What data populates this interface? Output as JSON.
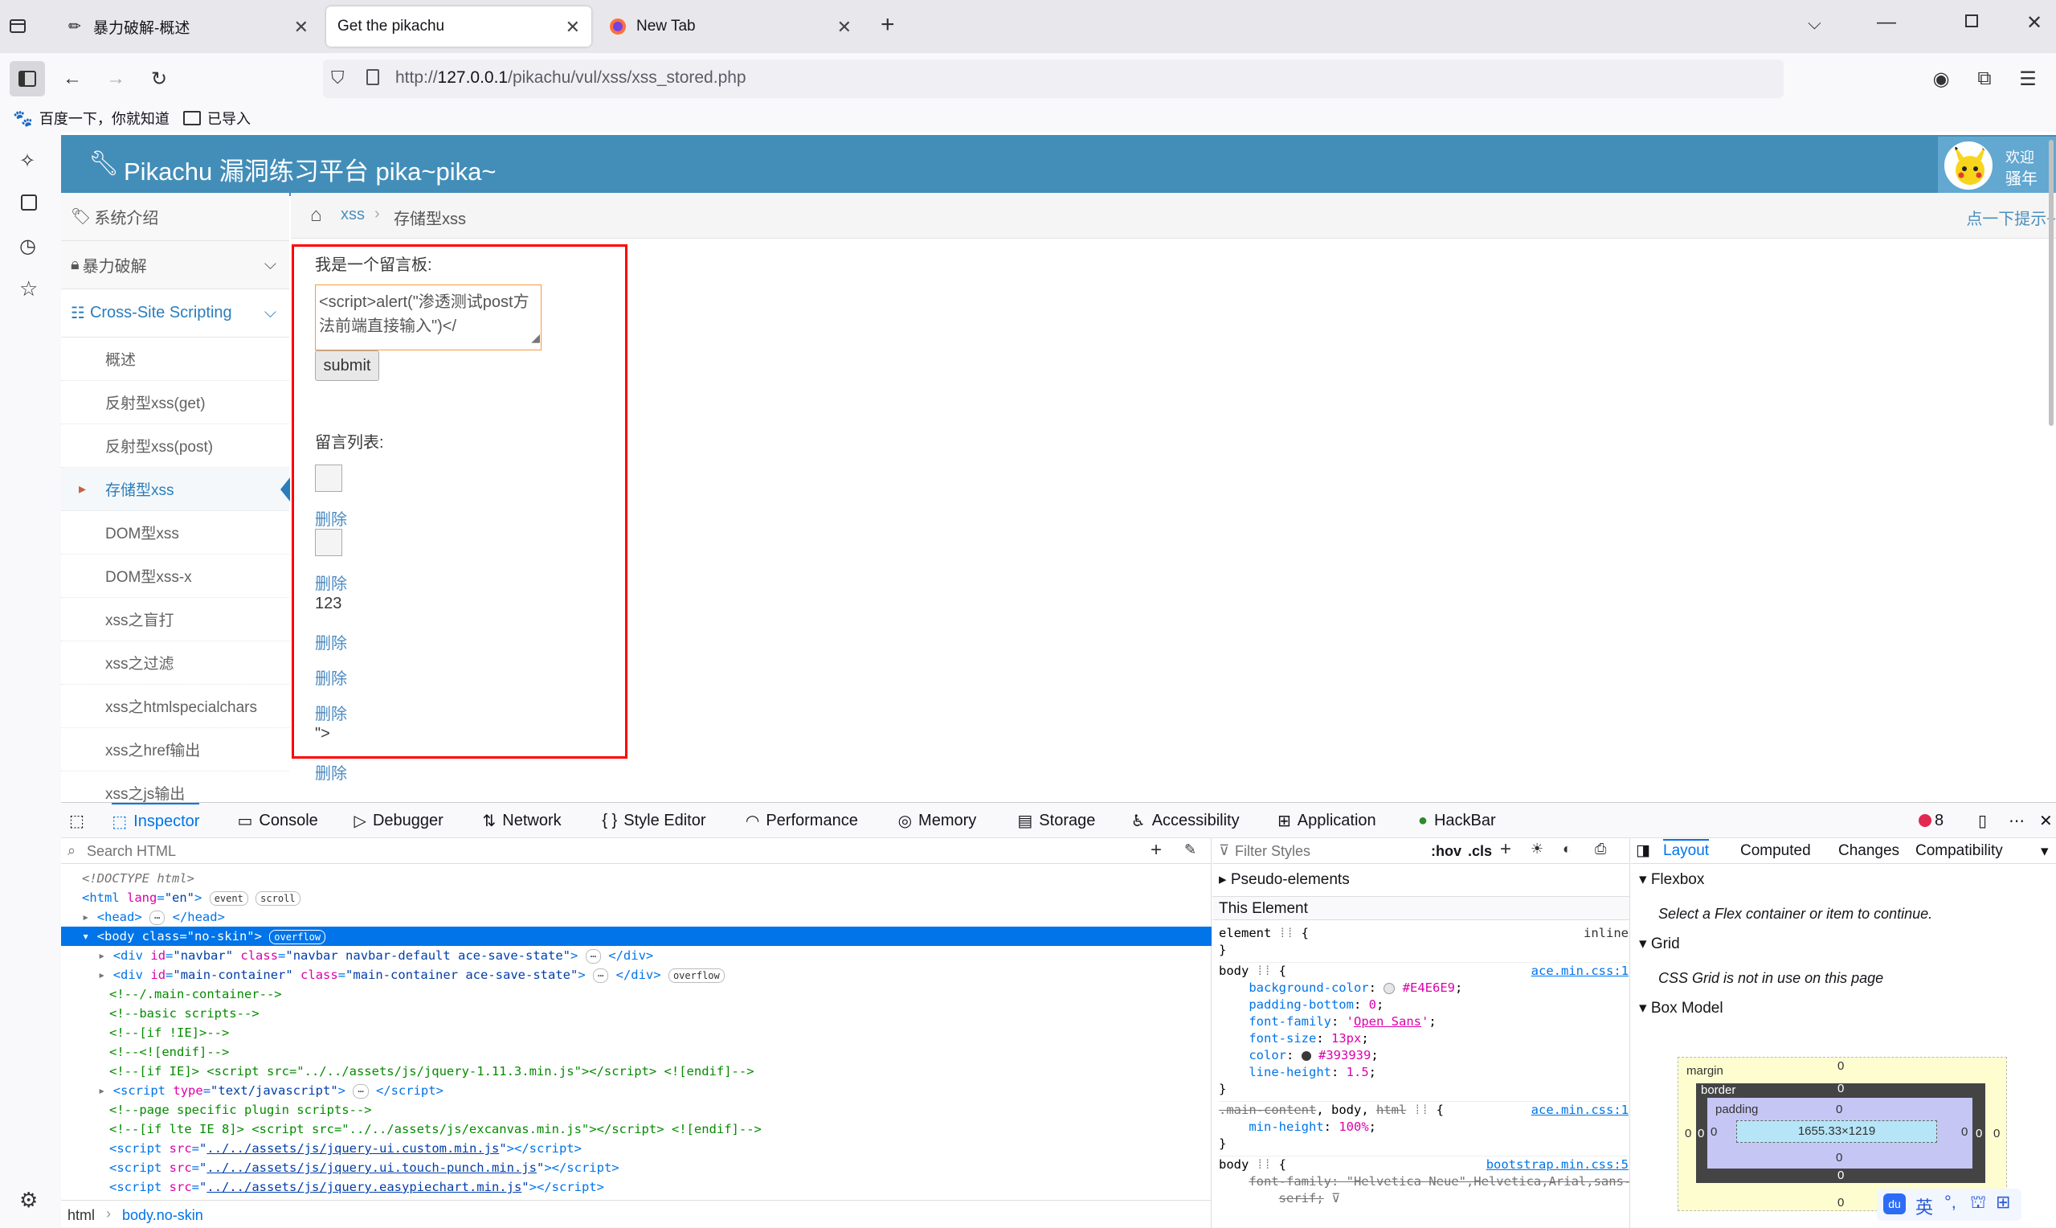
{
  "browser": {
    "tabs": [
      {
        "title": "暴力破解-概述",
        "active": false
      },
      {
        "title": "Get the pikachu",
        "active": true
      },
      {
        "title": "New Tab",
        "active": false
      }
    ],
    "url_prefix": "http://",
    "url_host": "127.0.0.1",
    "url_path": "/pikachu/vul/xss/xss_stored.php",
    "bookmarks": [
      "百度一下，你就知道",
      "已导入"
    ]
  },
  "app": {
    "title": "Pikachu 漏洞练习平台 pika~pika~",
    "welcome_line1": "欢迎",
    "welcome_line2": "骚年",
    "hint_link": "点一下提示~"
  },
  "menu": {
    "top": [
      {
        "label": "系统介绍",
        "icon": "tag-icon"
      },
      {
        "label": "暴力破解",
        "icon": "lock-icon"
      },
      {
        "label": "Cross-Site Scripting",
        "icon": "list-icon"
      }
    ],
    "sub": [
      "概述",
      "反射型xss(get)",
      "反射型xss(post)",
      "存储型xss",
      "DOM型xss",
      "DOM型xss-x",
      "xss之盲打",
      "xss之过滤",
      "xss之htmlspecialchars",
      "xss之href输出",
      "xss之js输出"
    ],
    "active_index": 3
  },
  "breadcrumb": {
    "parent": "xss",
    "current": "存储型xss"
  },
  "board": {
    "label": "我是一个留言板:",
    "textarea_value": "<script>alert(\"渗透测试post方法前端直接输入\")</",
    "submit": "submit",
    "list_label": "留言列表:",
    "delete_label": "删除",
    "message_text": "123",
    "trailing_text": "\">"
  },
  "devtools": {
    "tabs": [
      "Inspector",
      "Console",
      "Debugger",
      "Network",
      "Style Editor",
      "Performance",
      "Memory",
      "Storage",
      "Accessibility",
      "Application",
      "HackBar"
    ],
    "error_count": "8",
    "search_placeholder": "Search HTML",
    "filter_placeholder": "Filter Styles",
    "hov": ":hov",
    "cls": ".cls",
    "pseudo": "Pseudo-elements",
    "this_element": "This Element",
    "layout_tabs": [
      "Layout",
      "Computed",
      "Changes",
      "Compatibility"
    ],
    "flexbox": "Flexbox",
    "flexbox_msg": "Select a Flex container or item to continue.",
    "grid": "Grid",
    "grid_msg": "CSS Grid is not in use on this page",
    "boxmodel": "Box Model",
    "bm": {
      "margin": "margin",
      "border": "border",
      "padding": "padding",
      "size": "1655.33×1219",
      "zero": "0"
    },
    "crumb_html": "html",
    "crumb_body": "body.no-skin",
    "ime": [
      "英"
    ]
  },
  "colors": {
    "header": "#438eb9",
    "link": "#4a8bc2",
    "highlight": "#e4e6e9",
    "board_border": "#ff0000",
    "selection": "#0074e8"
  }
}
